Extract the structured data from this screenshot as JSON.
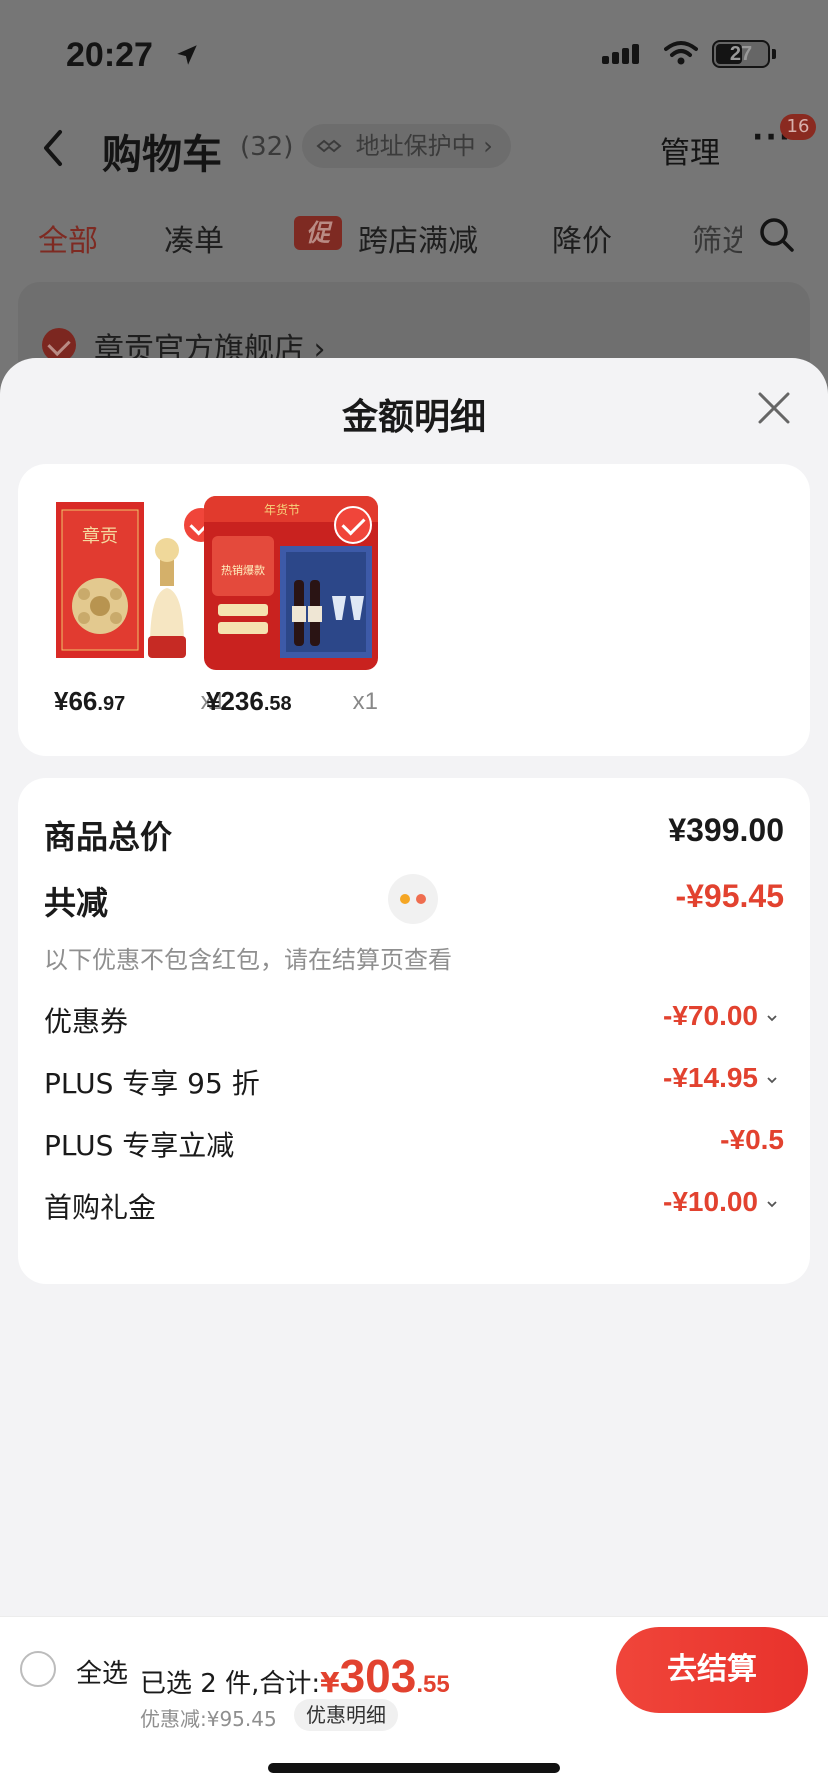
{
  "status_bar": {
    "time": "20:27",
    "battery": "27"
  },
  "nav": {
    "title": "购物车",
    "count": "(32)",
    "address_protect": "地址保护中",
    "manage": "管理",
    "more": "···",
    "more_badge": "16"
  },
  "filter_tabs": [
    {
      "label": "全部",
      "active": true
    },
    {
      "label": "凑单",
      "active": false
    },
    {
      "label": "跨店满减",
      "active": false,
      "promo": "促"
    },
    {
      "label": "降价",
      "active": false
    },
    {
      "label": "筛选",
      "active": false
    }
  ],
  "store": {
    "name": "章贡官方旗舰店"
  },
  "sheet": {
    "title": "金额明细",
    "products": [
      {
        "price_int": "¥66",
        "price_dec": ".97",
        "qty": "x1",
        "image": "baijiu-gift-box"
      },
      {
        "price_int": "¥236",
        "price_dec": ".58",
        "qty": "x1",
        "image": "red-wine-gift-set"
      }
    ],
    "summary": {
      "total_label": "商品总价",
      "total_value": "¥399.00",
      "reduce_label": "共减",
      "reduce_value": "-¥95.45",
      "note": "以下优惠不包含红包，请在结算页查看"
    },
    "discounts": [
      {
        "label": "优惠券",
        "value": "-¥70.00",
        "expandable": true
      },
      {
        "label": "PLUS 专享 95 折",
        "value": "-¥14.95",
        "expandable": true
      },
      {
        "label": "PLUS 专享立减",
        "value": "-¥0.5",
        "expandable": false
      },
      {
        "label": "首购礼金",
        "value": "-¥10.00",
        "expandable": true
      }
    ]
  },
  "bottom_bar": {
    "select_all": "全选",
    "selected_text": "已选 2 件,合计:",
    "currency": "¥",
    "total_int": "303",
    "total_dec": ".55",
    "discount_text": "优惠减:¥95.45",
    "detail_chip": "优惠明细",
    "checkout": "去结算"
  },
  "colors": {
    "accent": "#e2422f",
    "checkout": "#f0453a"
  }
}
